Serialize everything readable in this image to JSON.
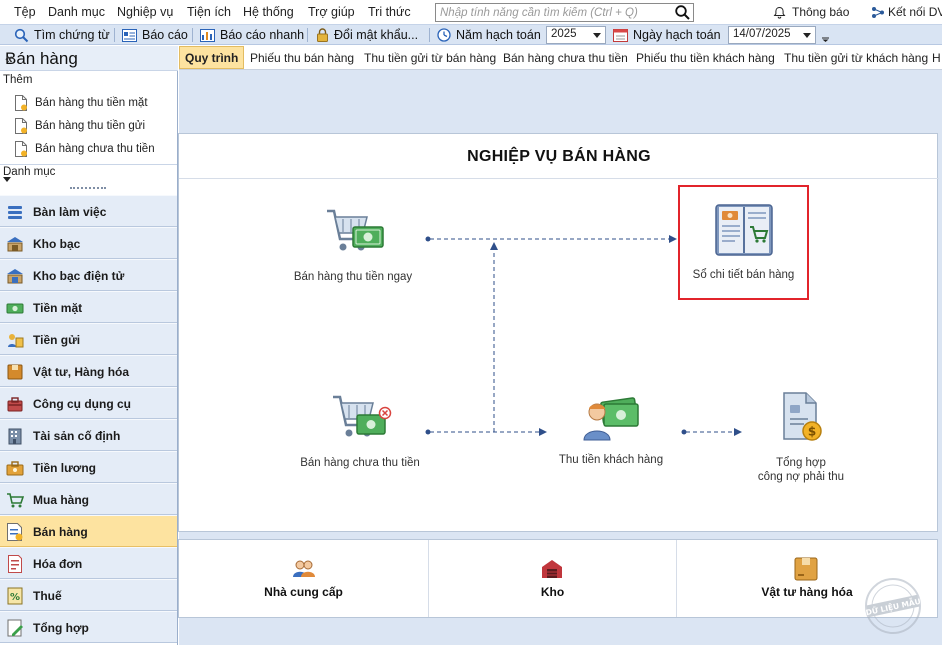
{
  "menu": [
    "Tệp",
    "Danh mục",
    "Nghiệp vụ",
    "Tiện ích",
    "Hệ thống",
    "Trợ giúp",
    "Tri thức"
  ],
  "search": {
    "placeholder": "Nhập tính năng cần tìm kiếm (Ctrl + Q)"
  },
  "top_right": {
    "notifications": "Thông báo",
    "connect": "Kết nối DV"
  },
  "toolbar": {
    "find_voucher": "Tìm chứng từ",
    "report": "Báo cáo",
    "quick_report": "Báo cáo nhanh",
    "change_password": "Đổi mật khẩu...",
    "fiscal_year_label": "Năm hạch toán",
    "fiscal_year_value": "2025",
    "posting_date_label": "Ngày hạch toán",
    "posting_date_value": "14/07/2025"
  },
  "sidebar": {
    "title": "Bán hàng",
    "collapse": "«",
    "add_label": "Thêm",
    "quick_links": [
      "Bán hàng thu tiền mặt",
      "Bán hàng thu tiền gửi",
      "Bán hàng chưa thu tiền"
    ],
    "category_label": "Danh mục",
    "nav": [
      {
        "label": "Bàn làm việc",
        "icon": "desk-icon"
      },
      {
        "label": "Kho bạc",
        "icon": "treasury-icon"
      },
      {
        "label": "Kho bạc điện tử",
        "icon": "e-treasury-icon"
      },
      {
        "label": "Tiền mặt",
        "icon": "cash-icon"
      },
      {
        "label": "Tiền gửi",
        "icon": "deposit-icon"
      },
      {
        "label": "Vật tư, Hàng hóa",
        "icon": "goods-icon"
      },
      {
        "label": "Công cụ dụng cụ",
        "icon": "tools-icon"
      },
      {
        "label": "Tài sản cố định",
        "icon": "fixed-asset-icon"
      },
      {
        "label": "Tiền lương",
        "icon": "salary-icon"
      },
      {
        "label": "Mua hàng",
        "icon": "purchase-icon"
      },
      {
        "label": "Bán hàng",
        "icon": "sales-icon"
      },
      {
        "label": "Hóa đơn",
        "icon": "invoice-icon"
      },
      {
        "label": "Thuế",
        "icon": "tax-icon"
      },
      {
        "label": "Tổng hợp",
        "icon": "summary-icon"
      }
    ],
    "active_index": 10
  },
  "tabs": [
    "Quy trình",
    "Phiếu thu bán hàng",
    "Thu tiền gửi từ bán hàng",
    "Bán hàng chưa thu tiền",
    "Phiếu thu tiền khách hàng",
    "Thu tiền gửi từ khách hàng",
    "H"
  ],
  "process": {
    "title": "NGHIỆP VỤ BÁN HÀNG",
    "nodes": {
      "cash_sale": "Bán hàng thu tiền ngay",
      "sales_ledger": "Sổ chi tiết bán hàng",
      "credit_sale": "Bán hàng chưa thu tiền",
      "collect": "Thu tiền khách hàng",
      "receivable_line1": "Tổng hợp",
      "receivable_line2": "công nợ phải thu"
    }
  },
  "bottom": {
    "supplier": "Nhà cung cấp",
    "warehouse": "Kho",
    "goods": "Vật tư hàng hóa"
  },
  "watermark": "DỮ LIỆU MẪU",
  "colors": {
    "accent_active": "#fde3a0",
    "highlight": "#e2242b",
    "toolbar": "#d9e4f3"
  }
}
